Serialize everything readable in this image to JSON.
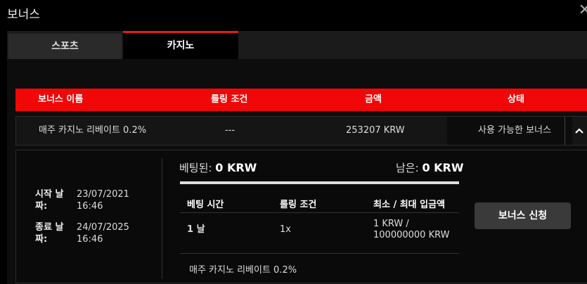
{
  "modal": {
    "title": "보너스",
    "close_glyph": "✕"
  },
  "tabs": [
    {
      "label": "스포츠",
      "active": false
    },
    {
      "label": "카지노",
      "active": true
    }
  ],
  "table": {
    "headers": [
      "보너스 이름",
      "롤링 조건",
      "금액",
      "상태"
    ],
    "row": {
      "name": "매주 카지노 리베이트 0.2%",
      "rolling": "---",
      "amount": "253207 KRW",
      "status": "사용 가능한 보너스"
    }
  },
  "detail": {
    "start_label": "시작 날\n짜:",
    "start_value": "23/07/2021\n16:46",
    "end_label": "종료 날\n짜:",
    "end_value": "24/07/2025\n16:46",
    "bet_prefix": "베팅된: ",
    "bet_amount": "0 KRW",
    "remaining_prefix": "남은: ",
    "remaining_amount": "0 KRW",
    "progress_fraction": 0,
    "sub_headers": [
      "베팅 시간",
      "롤링 조건",
      "최소 / 최대 입금액"
    ],
    "sub_row": {
      "time": "1 날",
      "rolling": "1x",
      "deposit": "1 KRW /\n100000000 KRW"
    },
    "footnote": "매주 카지노 리베이트 0.2%",
    "apply_label": "보너스 신청"
  },
  "colors": {
    "accent": "#e8191c",
    "header_bg": "#f10707",
    "button_bg": "#3a3a3a"
  }
}
